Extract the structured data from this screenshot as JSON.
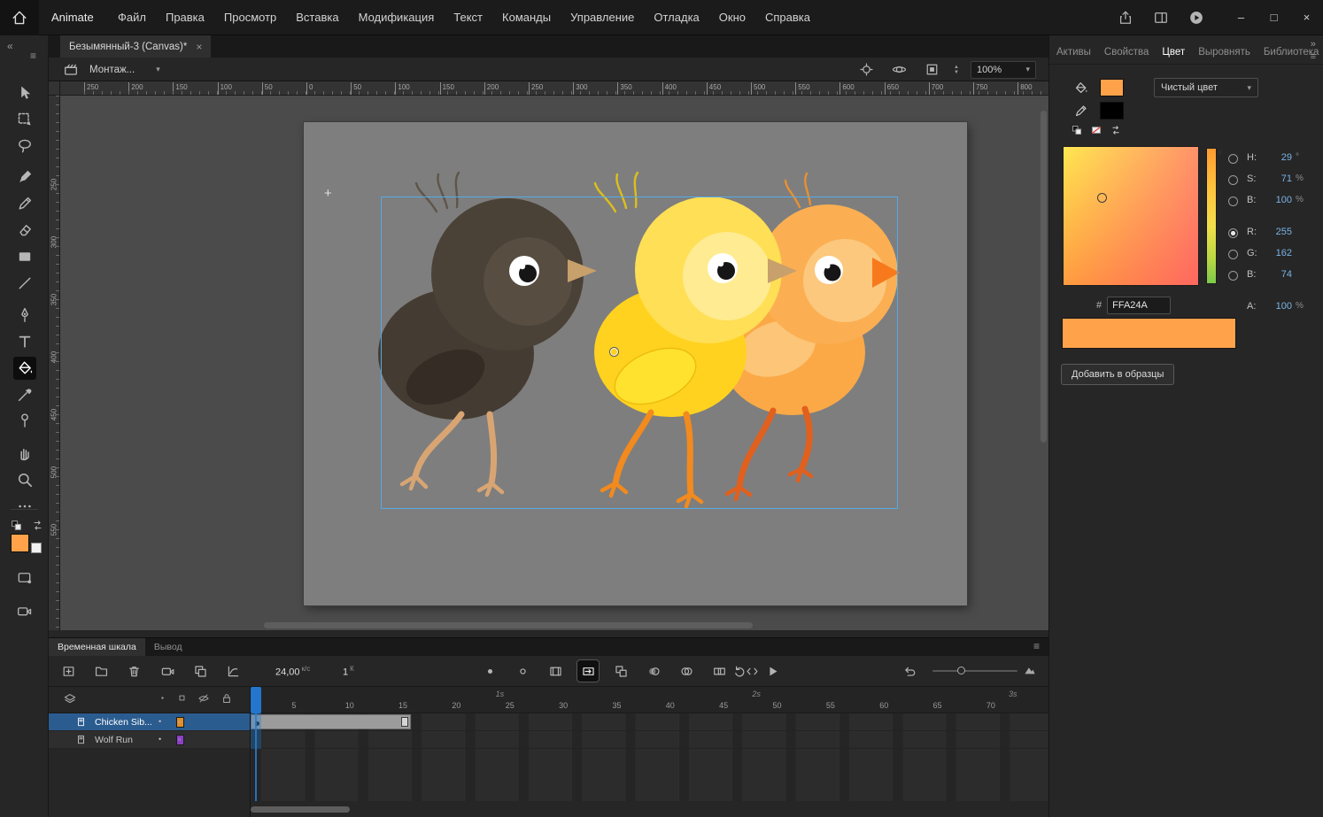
{
  "window": {
    "app_label": "Animate",
    "doc_tab": {
      "title": "Безымянный-3 (Canvas)*",
      "close_glyph": "×"
    },
    "controls": {
      "minimize": "–",
      "maximize": "□",
      "close": "×"
    }
  },
  "glyphs": {
    "collapse_left": "«",
    "expand_right": "»",
    "menu": "≡",
    "chevron_down": "▾",
    "step_up": "▲",
    "step_down": "▼",
    "crosshair_cursor": "+",
    "bullet": "•",
    "outline_square": "▫"
  },
  "menubar": {
    "items": [
      "Файл",
      "Правка",
      "Просмотр",
      "Вставка",
      "Модификация",
      "Текст",
      "Команды",
      "Управление",
      "Отладка",
      "Окно",
      "Справка"
    ]
  },
  "topbar_icons": [
    {
      "name": "share",
      "icon": "share"
    },
    {
      "name": "workspace-layout",
      "icon": "layout"
    },
    {
      "name": "publish-preview",
      "icon": "playcircle"
    }
  ],
  "edit_bar": {
    "scene_name": "Монтаж...",
    "zoom_value": "100%"
  },
  "edit_bar_icons": [
    {
      "name": "center-stage",
      "icon": "crosshair"
    },
    {
      "name": "rotate-view",
      "icon": "orbit"
    },
    {
      "name": "clip-to-stage",
      "icon": "clip"
    }
  ],
  "tools": [
    {
      "name": "selection",
      "icon": "select"
    },
    {
      "name": "free-transform",
      "icon": "transform"
    },
    {
      "name": "lasso",
      "icon": "lasso"
    },
    {
      "name": "fluid-brush",
      "icon": "brush"
    },
    {
      "name": "classic-brush",
      "icon": "pencil"
    },
    {
      "name": "eraser",
      "icon": "eraser"
    },
    {
      "name": "rectangle",
      "icon": "shape"
    },
    {
      "name": "line",
      "icon": "line"
    },
    {
      "name": "pen",
      "icon": "pen"
    },
    {
      "name": "text",
      "icon": "text"
    },
    {
      "name": "paint-bucket",
      "icon": "bucket",
      "active": true
    },
    {
      "name": "eyedropper",
      "icon": "eyedropper"
    },
    {
      "name": "asset-warp",
      "icon": "pin"
    },
    {
      "name": "hand",
      "icon": "hand"
    },
    {
      "name": "zoom",
      "icon": "zoom"
    },
    {
      "name": "more-tools",
      "icon": "more"
    }
  ],
  "tool_extras": [
    {
      "name": "default-colors",
      "icon": "bwchips"
    },
    {
      "name": "swap-colors",
      "icon": "swap"
    }
  ],
  "tool_bottom": [
    {
      "name": "object-drawing-mode",
      "icon": "objdraw"
    },
    {
      "name": "camera-tool",
      "icon": "camera"
    }
  ],
  "canvas": {
    "h_ruler_labels": [
      "250",
      "200",
      "150",
      "100",
      "50",
      "0",
      "50",
      "100",
      "150",
      "200",
      "250",
      "300",
      "350",
      "400",
      "450",
      "500",
      "550",
      "600",
      "650",
      "700",
      "750",
      "800"
    ],
    "v_ruler_labels": [
      "250",
      "300",
      "350",
      "400",
      "450",
      "500",
      "550"
    ],
    "stage": {
      "color": "#7E7E7E",
      "artwork": "three walking cartoon chicks",
      "chick_colors": {
        "left": "#4A4137",
        "middle": "#FFD21F",
        "right": "#FBA947"
      }
    }
  },
  "right_panel": {
    "tabs": [
      {
        "label": "Активы",
        "active": false
      },
      {
        "label": "Свойства",
        "active": false
      },
      {
        "label": "Цвет",
        "active": true
      },
      {
        "label": "Выровнять",
        "active": false
      },
      {
        "label": "Библиотека",
        "active": false
      }
    ],
    "color": {
      "fill_swatch": "#FFA24A",
      "stroke_swatch": "#000000",
      "type_value": "Чистый цвет",
      "hsb": [
        {
          "label": "H:",
          "value": "29",
          "unit": "°"
        },
        {
          "label": "S:",
          "value": "71",
          "unit": "%"
        },
        {
          "label": "B:",
          "value": "100",
          "unit": "%"
        }
      ],
      "rgb": [
        {
          "label": "R:",
          "value": "255",
          "unit": "",
          "selected": true
        },
        {
          "label": "G:",
          "value": "162",
          "unit": ""
        },
        {
          "label": "B:",
          "value": "74",
          "unit": ""
        }
      ],
      "alpha": {
        "label": "A:",
        "value": "100",
        "unit": "%"
      },
      "hex_prefix": "#",
      "hex_value": "FFA24A",
      "add_button_label": "Добавить в образцы"
    }
  },
  "timeline": {
    "tabs": [
      {
        "label": "Временная шкала",
        "active": true
      },
      {
        "label": "Вывод",
        "active": false
      }
    ],
    "fps_value": "24,00",
    "fps_unit": "к/с",
    "frame_value": "1",
    "frame_unit": "К",
    "toolbar_left": [
      {
        "name": "insert-frame",
        "icon": "frameplus"
      },
      {
        "name": "new-folder",
        "icon": "folder"
      },
      {
        "name": "delete-layer",
        "icon": "trash"
      }
    ],
    "toolbar_media": [
      {
        "name": "add-camera",
        "icon": "camera"
      },
      {
        "name": "layer-depth",
        "icon": "layers2"
      },
      {
        "name": "graph-editor",
        "icon": "graph"
      }
    ],
    "toolbar_center": [
      {
        "name": "insert-keyframe",
        "icon": "kf"
      },
      {
        "name": "insert-blank-keyframe",
        "icon": "kfblank"
      },
      {
        "name": "insert-frames",
        "icon": "film"
      },
      {
        "name": "create-motion-tween",
        "icon": "tween",
        "pressed": true
      },
      {
        "name": "frame-options",
        "icon": "chips"
      },
      {
        "name": "onion-skin",
        "icon": "onion"
      },
      {
        "name": "onion-skin-outlines",
        "icon": "onion2"
      },
      {
        "name": "edit-multiple-frames",
        "icon": "multiframe"
      },
      {
        "name": "modify-markers",
        "icon": "code"
      }
    ],
    "toolbar_play": [
      {
        "name": "loop-playback",
        "icon": "loop"
      },
      {
        "name": "play",
        "icon": "play"
      }
    ],
    "toolbar_right": [
      {
        "name": "step-back",
        "icon": "undo"
      }
    ],
    "layers": [
      {
        "name": "Chicken Sib...",
        "color": "#E08E2B",
        "selected": true,
        "span_frames": 15
      },
      {
        "name": "Wolf Run",
        "color": "#8B3FC6",
        "selected": false,
        "span_frames": 0
      }
    ],
    "frame_numbers": [
      "5",
      "10",
      "15",
      "20",
      "25",
      "30",
      "35",
      "40",
      "45",
      "50",
      "55",
      "60",
      "65",
      "70"
    ],
    "second_markers": [
      "1s",
      "2s",
      "3s"
    ]
  }
}
